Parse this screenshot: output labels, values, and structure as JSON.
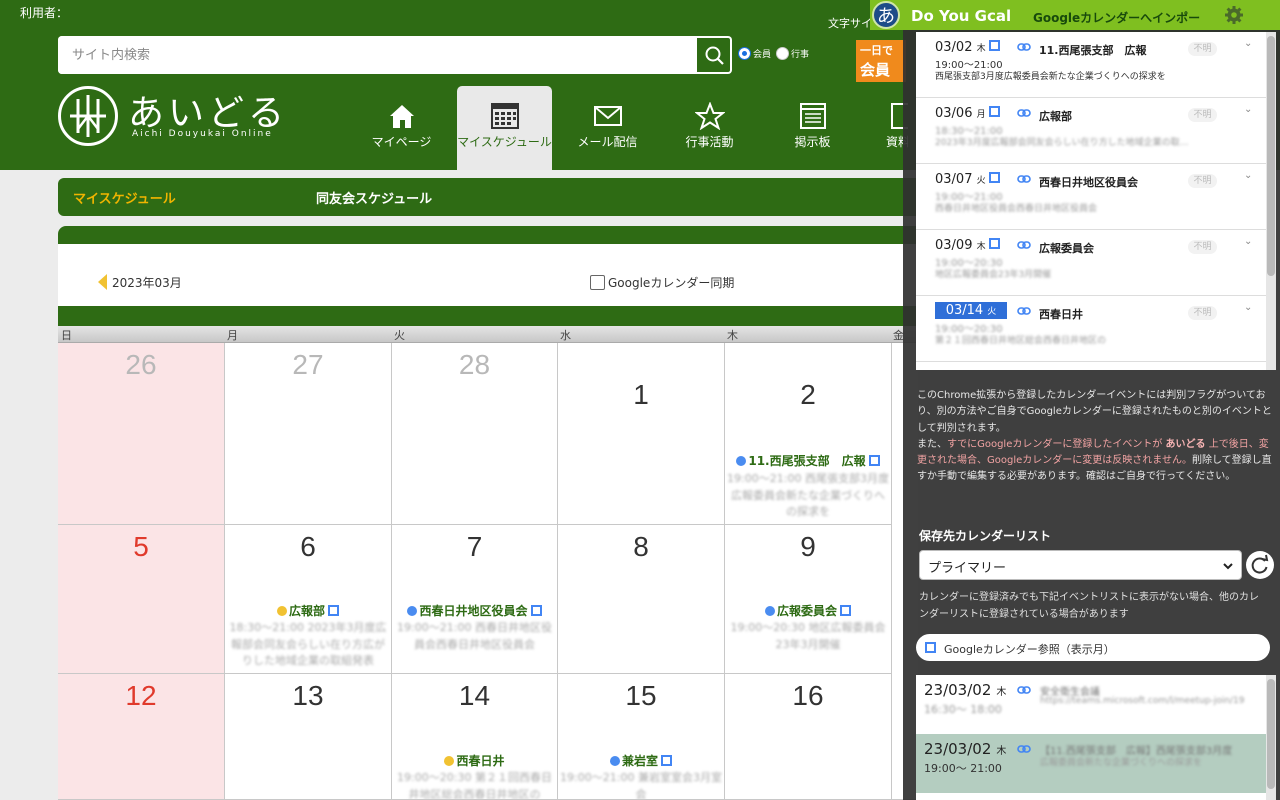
{
  "header": {
    "user_label": "利用者：",
    "font_size_label": "文字サイ",
    "search_placeholder": "サイト内検索",
    "radio_member": "会員",
    "radio_event": "行事",
    "banner_line1": "一日で",
    "banner_line2": "会員",
    "logo_text": "あいどる",
    "logo_sub": "Aichi Douyukai Online",
    "nav": [
      {
        "label": "マイページ",
        "icon": "home-icon"
      },
      {
        "label": "マイスケジュール",
        "icon": "calendar-icon"
      },
      {
        "label": "メール配信",
        "icon": "mail-icon"
      },
      {
        "label": "行事活動",
        "icon": "star-icon"
      },
      {
        "label": "掲示板",
        "icon": "board-icon"
      },
      {
        "label": "資料",
        "icon": "document-icon"
      }
    ]
  },
  "subbar": {
    "my_schedule": "マイスケジュール",
    "club_schedule": "同友会スケジュール"
  },
  "calendar": {
    "month_label": "2023年03月",
    "gcal_sync": "Googleカレンダー同期",
    "dow": [
      "日",
      "月",
      "火",
      "水",
      "木",
      "金"
    ],
    "week1": [
      "26",
      "27",
      "28",
      "1",
      "2"
    ],
    "week2": [
      "5",
      "6",
      "7",
      "8",
      "9"
    ],
    "week3": [
      "12",
      "13",
      "14",
      "15",
      "16"
    ],
    "events": {
      "e_0302": {
        "title": "11.西尾張支部　広報",
        "blur": "19:00〜21:00 西尾張支部3月度広報委員会新たな企業づくりへの探求を"
      },
      "e_0306": {
        "title": "広報部",
        "blur": "18:30〜21:00 2023年3月度広報部会同友会らしい在り方広がりした地域企業の取組発表"
      },
      "e_0307": {
        "title": "西春日井地区役員会",
        "blur": "19:00〜21:00 西春日井地区役員会西春日井地区役員会"
      },
      "e_0309": {
        "title": "広報委員会",
        "blur": "19:00〜20:30 地区広報委員会23年3月開催"
      },
      "e_0314": {
        "title": "西春日井",
        "blur": "19:00〜20:30 第２１回西春日井地区総会西春日井地区の"
      },
      "e_0315": {
        "title": "兼岩室",
        "blur": "19:00〜21:00 兼岩室室会3月室会"
      }
    }
  },
  "extension": {
    "title": "Do You Gcal",
    "subtitle": "Googleカレンダーへインポー",
    "list": [
      {
        "date": "03/02",
        "dow": "木",
        "title": "11.西尾張支部　広報",
        "flag": "不明",
        "time": "19:00〜21:00",
        "desc": "西尾張支部3月度広報委員会新たな企業づくりへの探求を"
      },
      {
        "date": "03/06",
        "dow": "月",
        "title": "広報部",
        "flag": "不明",
        "time": "18:30〜21:00",
        "desc": "2023年3月度広報部会同友会らしい在り方した地域企業の取…"
      },
      {
        "date": "03/07",
        "dow": "火",
        "title": "西春日井地区役員会",
        "flag": "不明",
        "time": "19:00〜21:00",
        "desc": "西春日井地区役員会西春日井地区役員会"
      },
      {
        "date": "03/09",
        "dow": "木",
        "title": "広報委員会",
        "flag": "不明",
        "time": "19:00〜20:30",
        "desc": "地区広報委員会23年3月開催"
      },
      {
        "date": "03/14",
        "dow": "火",
        "title": "西春日井",
        "flag": "不明",
        "time": "19:00〜20:30",
        "desc": "第２１回西春日井地区総会西春日井地区の"
      }
    ],
    "info_1": "このChrome拡張から登録したカレンダーイベントには判別フラグがついており、別の方法やご自身でGoogleカレンダーに登録されたものと別のイベントとして判別されます。",
    "info_2a": "また、",
    "info_2b": "すでにGoogleカレンダーに登録したイベントが ",
    "info_2c": "あいどる",
    "info_2d": " 上で後日、変更された場合、Googleカレンダーに変更は反映されません。",
    "info_2e": "削除して登録し直すか手動で編集する必要があります。確認はご自身で行ってください。",
    "save_cal_label": "保存先カレンダーリスト",
    "calendar_value": "プライマリー",
    "note": "カレンダーに登録済みでも下記イベントリストに表示がない場合、他のカレンダーリストに登録されている場合があります",
    "gcal_ref": "Googleカレンダー参照（表示月）",
    "gcal_items": [
      {
        "date": "23/03/02",
        "dow": "木",
        "time": "16:30〜 18:00",
        "title": "安全衛生会議",
        "blur": "https://teams.microsoft.com/l/meetup-join/19"
      },
      {
        "date": "23/03/02",
        "dow": "木",
        "time": "19:00〜 21:00",
        "title": "【11.西尾張支部　広報】西尾張支部3月度",
        "blur": "広報委員会新たな企業づくりへの探求を"
      }
    ]
  }
}
